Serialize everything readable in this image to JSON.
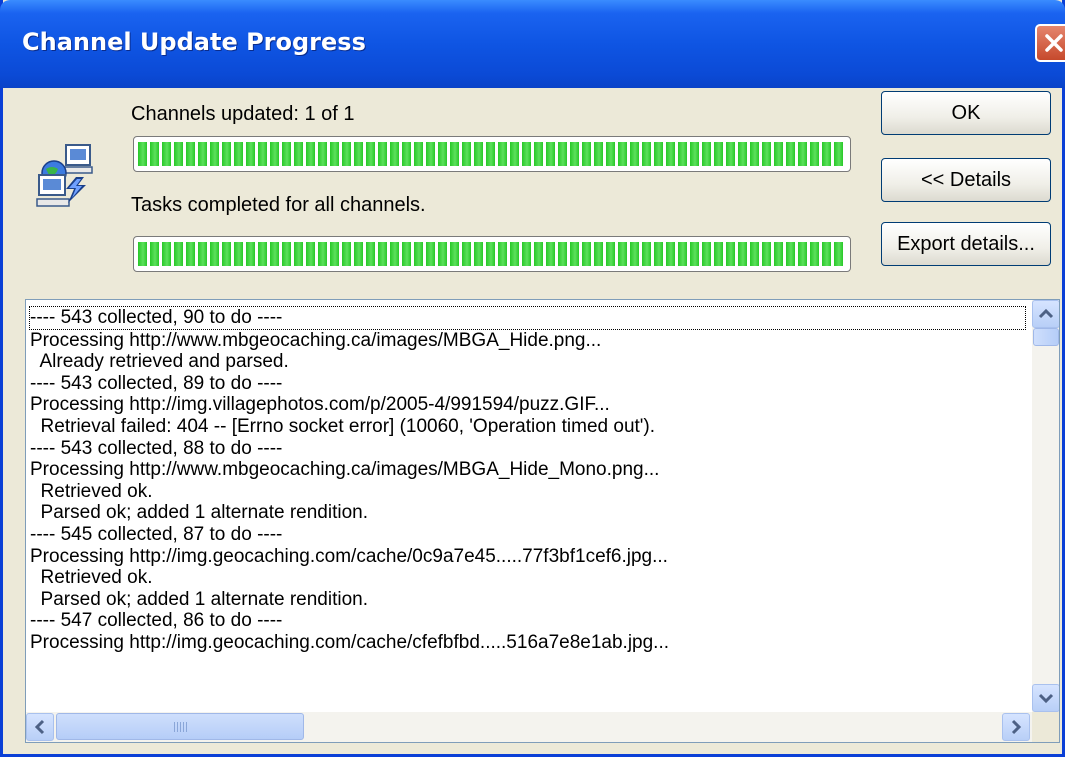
{
  "window": {
    "title": "Channel Update Progress",
    "close_icon": "close-icon"
  },
  "status": {
    "channels_label": "Channels updated: 1 of 1",
    "channels_progress": 1.0,
    "tasks_label": "Tasks completed for all channels.",
    "tasks_progress": 1.0
  },
  "buttons": {
    "ok": "OK",
    "details": "<< Details",
    "export": "Export details..."
  },
  "icons": {
    "app": "network-computers-icon"
  },
  "log": {
    "lines": [
      "---- 543 collected, 90 to do ----",
      "Processing http://www.mbgeocaching.ca/images/MBGA_Hide.png...",
      "  Already retrieved and parsed.",
      "---- 543 collected, 89 to do ----",
      "Processing http://img.villagephotos.com/p/2005-4/991594/puzz.GIF...",
      "  Retrieval failed: 404 -- [Errno socket error] (10060, 'Operation timed out').",
      "---- 543 collected, 88 to do ----",
      "Processing http://www.mbgeocaching.ca/images/MBGA_Hide_Mono.png...",
      "  Retrieved ok.",
      "  Parsed ok; added 1 alternate rendition.",
      "---- 545 collected, 87 to do ----",
      "Processing http://img.geocaching.com/cache/0c9a7e45.....77f3bf1cef6.jpg...",
      "  Retrieved ok.",
      "  Parsed ok; added 1 alternate rendition.",
      "---- 547 collected, 86 to do ----",
      "Processing http://img.geocaching.com/cache/cfefbfbd.....516a7e8e1ab.jpg..."
    ]
  },
  "colors": {
    "titlebar": "#0b4ad6",
    "progress_fill": "#28c828",
    "dialog_bg": "#ece9d8"
  }
}
